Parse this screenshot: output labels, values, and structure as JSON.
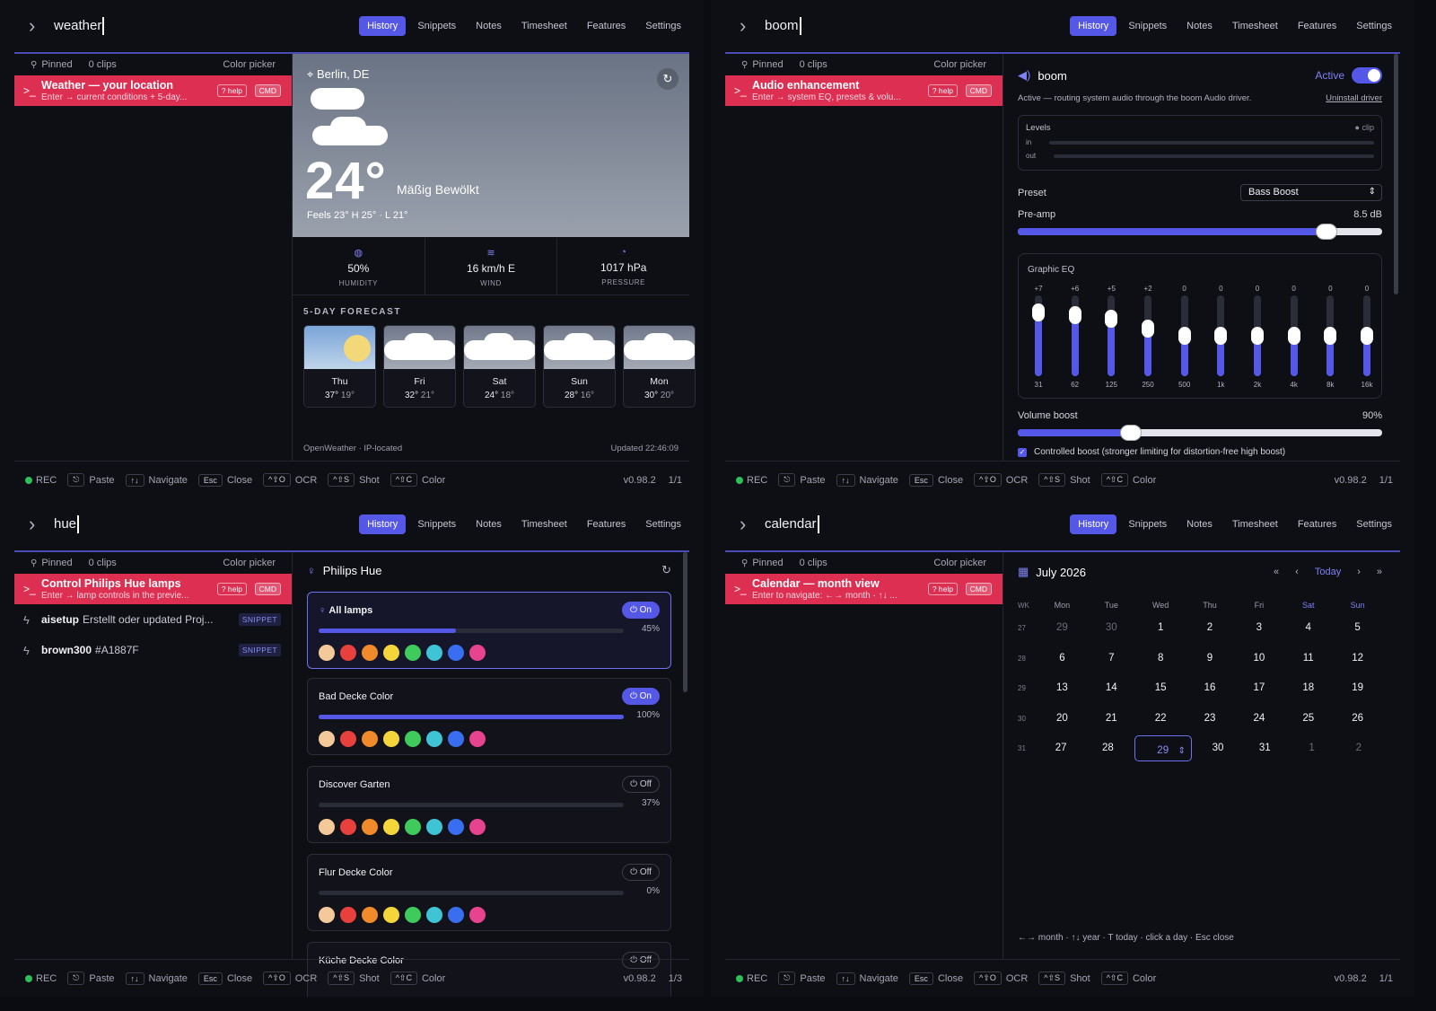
{
  "tabs": [
    "History",
    "Snippets",
    "Notes",
    "Timesheet",
    "Features",
    "Settings"
  ],
  "footer": {
    "rec": "REC",
    "paste_key": "⎋",
    "paste": "Paste",
    "nav_key": "↑↓",
    "nav": "Navigate",
    "esc_key": "Esc",
    "close": "Close",
    "ocr_key": "^⇧O",
    "ocr": "OCR",
    "shot_key": "^⇧S",
    "shot": "Shot",
    "color_key": "^⇧C",
    "color": "Color",
    "version": "v0.98.2"
  },
  "sidebar_head": {
    "pinned": "Pinned",
    "clips": "0 clips",
    "color_picker": "Color picker"
  },
  "badges": {
    "help": "? help",
    "cmd": "CMD"
  },
  "weather": {
    "query": "weather",
    "page": "1/1",
    "cmd_title": "Weather — your location",
    "cmd_sub": "Enter → current conditions + 5-day...",
    "location": "Berlin, DE",
    "temp": "24°",
    "condition": "Mäßig Bewölkt",
    "feels": "Feels 23°    H 25° · L 21°",
    "stats": [
      {
        "value": "50%",
        "label": "HUMIDITY"
      },
      {
        "value": "16 km/h E",
        "label": "WIND"
      },
      {
        "value": "1017 hPa",
        "label": "PRESSURE"
      }
    ],
    "forecast_title": "5-DAY FORECAST",
    "forecast": [
      {
        "day": "Thu",
        "hi": "37°",
        "lo": "19°"
      },
      {
        "day": "Fri",
        "hi": "32°",
        "lo": "21°"
      },
      {
        "day": "Sat",
        "hi": "24°",
        "lo": "18°"
      },
      {
        "day": "Sun",
        "hi": "28°",
        "lo": "16°"
      },
      {
        "day": "Mon",
        "hi": "30°",
        "lo": "20°"
      }
    ],
    "source": "OpenWeather · IP-located",
    "updated": "Updated 22:46:09"
  },
  "boom": {
    "query": "boom",
    "page": "1/1",
    "cmd_title": "Audio enhancement",
    "cmd_sub": "Enter → system EQ, presets & volu...",
    "name": "boom",
    "active": "Active",
    "sub": "Active — routing system audio through the boom Audio driver.",
    "uninstall": "Uninstall driver",
    "levels": "Levels",
    "clip": "clip",
    "in": "in",
    "out": "out",
    "preset_label": "Preset",
    "preset": "Bass Boost",
    "preamp_label": "Pre-amp",
    "preamp": "8.5 dB",
    "preamp_fraction": 0.82,
    "eq_title": "Graphic EQ",
    "bands": [
      {
        "f": "31",
        "g": "+7",
        "v": 7
      },
      {
        "f": "62",
        "g": "+6",
        "v": 6
      },
      {
        "f": "125",
        "g": "+5",
        "v": 5
      },
      {
        "f": "250",
        "g": "+2",
        "v": 2
      },
      {
        "f": "500",
        "g": "0",
        "v": 0
      },
      {
        "f": "1k",
        "g": "0",
        "v": 0
      },
      {
        "f": "2k",
        "g": "0",
        "v": 0
      },
      {
        "f": "4k",
        "g": "0",
        "v": 0
      },
      {
        "f": "8k",
        "g": "0",
        "v": 0
      },
      {
        "f": "16k",
        "g": "0",
        "v": 0
      }
    ],
    "volume_label": "Volume boost",
    "volume": "90%",
    "volume_fraction": 0.3,
    "controlled": "Controlled boost (stronger limiting for distortion-free high boost)"
  },
  "hue": {
    "query": "hue",
    "page": "1/3",
    "cmd_title": "Control Philips Hue lamps",
    "cmd_sub": "Enter → lamp controls in the previe...",
    "snippets": [
      {
        "name": "aisetup",
        "text": "Erstellt oder updated Proj...",
        "tag": "SNIPPET"
      },
      {
        "name": "brown300",
        "text": "#A1887F",
        "tag": "SNIPPET"
      }
    ],
    "title": "Philips Hue",
    "lamps": [
      {
        "name": "All lamps",
        "state": "On",
        "pct": "45%",
        "level": 0.45
      },
      {
        "name": "Bad Decke Color",
        "state": "On",
        "pct": "100%",
        "level": 1.0
      },
      {
        "name": "Discover Garten",
        "state": "Off",
        "pct": "37%",
        "level": 0.0
      },
      {
        "name": "Flur Decke Color",
        "state": "Off",
        "pct": "0%",
        "level": 0.0
      },
      {
        "name": "Küche Decke Color",
        "state": "Off",
        "pct": "",
        "level": 0.0
      }
    ],
    "swatch_colors": [
      "#f4c99a",
      "#e8403c",
      "#f08a2a",
      "#f5d63a",
      "#3fca5c",
      "#3fc4d6",
      "#3a6ef0",
      "#e8438e"
    ]
  },
  "calendar": {
    "query": "calendar",
    "page": "1/1",
    "cmd_title": "Calendar — month view",
    "cmd_sub": "Enter to navigate: ←→ month · ↑↓ ...",
    "month": "July 2026",
    "today": "Today",
    "headers": [
      "WK",
      "Mon",
      "Tue",
      "Wed",
      "Thu",
      "Fri",
      "Sat",
      "Sun"
    ],
    "weeks": [
      {
        "wk": "27",
        "days": [
          "29",
          "30",
          "1",
          "2",
          "3",
          "4",
          "5"
        ]
      },
      {
        "wk": "28",
        "days": [
          "6",
          "7",
          "8",
          "9",
          "10",
          "11",
          "12"
        ]
      },
      {
        "wk": "29",
        "days": [
          "13",
          "14",
          "15",
          "16",
          "17",
          "18",
          "19"
        ]
      },
      {
        "wk": "30",
        "days": [
          "20",
          "21",
          "22",
          "23",
          "24",
          "25",
          "26"
        ]
      },
      {
        "wk": "31",
        "days": [
          "27",
          "28",
          "29",
          "30",
          "31",
          "1",
          "2"
        ]
      }
    ],
    "footer": "←→ month · ↑↓ year · T today · click a day · Esc close"
  }
}
